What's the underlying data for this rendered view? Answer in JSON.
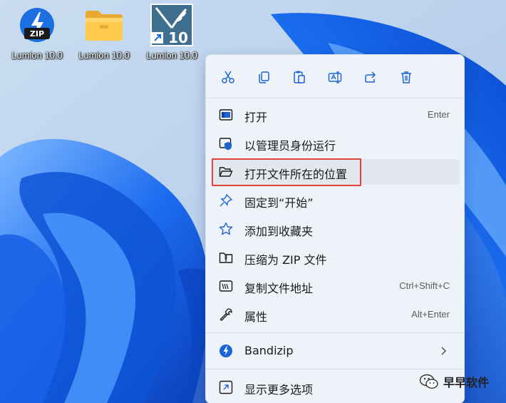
{
  "desktop": {
    "icons": [
      {
        "label": "Lumion 10.0",
        "icon": "zip-archive-icon"
      },
      {
        "label": "Lumion 10.0",
        "icon": "folder-icon"
      },
      {
        "label": "Lumion 10.0",
        "icon": "lumion-shortcut-icon"
      }
    ]
  },
  "toolbar": [
    {
      "icon": "cut-icon"
    },
    {
      "icon": "copy-icon"
    },
    {
      "icon": "paste-icon"
    },
    {
      "icon": "rename-icon"
    },
    {
      "icon": "share-icon"
    },
    {
      "icon": "delete-icon"
    }
  ],
  "menu": {
    "items": [
      {
        "label": "打开",
        "shortcut": "Enter",
        "icon": "open-app-icon"
      },
      {
        "label": "以管理员身份运行",
        "shortcut": "",
        "icon": "shield-icon"
      },
      {
        "label": "打开文件所在的位置",
        "shortcut": "",
        "icon": "folder-open-icon"
      },
      {
        "label": "固定到“开始”",
        "shortcut": "",
        "icon": "pin-icon"
      },
      {
        "label": "添加到收藏夹",
        "shortcut": "",
        "icon": "star-icon"
      },
      {
        "label": "压缩为 ZIP 文件",
        "shortcut": "",
        "icon": "zip-icon"
      },
      {
        "label": "复制文件地址",
        "shortcut": "Ctrl+Shift+C",
        "icon": "copy-path-icon"
      },
      {
        "label": "属性",
        "shortcut": "Alt+Enter",
        "icon": "wrench-icon"
      }
    ],
    "bandizip": {
      "label": "Bandizip",
      "icon": "bandizip-icon"
    },
    "more": {
      "label": "显示更多选项",
      "icon": "more-options-icon"
    }
  },
  "watermark": {
    "text": "早早软件"
  },
  "colors": {
    "accent": "#1c63d4",
    "highlight_border": "#e0443e",
    "menu_bg": "#eef3f9"
  }
}
